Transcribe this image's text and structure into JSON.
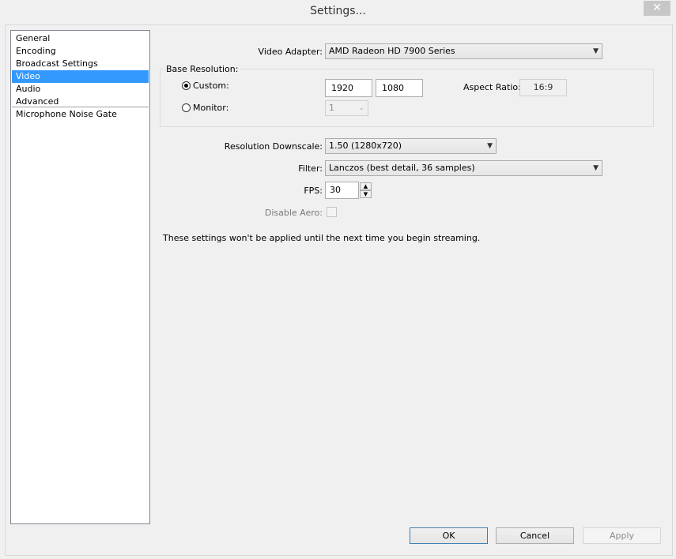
{
  "window": {
    "title": "Settings..."
  },
  "sidebar": {
    "items": [
      {
        "label": "General"
      },
      {
        "label": "Encoding"
      },
      {
        "label": "Broadcast Settings"
      },
      {
        "label": "Video"
      },
      {
        "label": "Audio"
      },
      {
        "label": "Advanced"
      },
      {
        "label": "Microphone Noise Gate"
      }
    ],
    "selected": "Video"
  },
  "video": {
    "adapter_label": "Video Adapter:",
    "adapter_value": "AMD Radeon HD 7900 Series",
    "base_resolution_label": "Base Resolution:",
    "custom_label": "Custom:",
    "custom_width": "1920",
    "custom_height": "1080",
    "aspect_ratio_label": "Aspect Ratio:",
    "aspect_ratio_value": "16:9",
    "monitor_label": "Monitor:",
    "monitor_value": "1",
    "downscale_label": "Resolution Downscale:",
    "downscale_value": "1.50  (1280x720)",
    "filter_label": "Filter:",
    "filter_value": "Lanczos (best detail, 36 samples)",
    "fps_label": "FPS:",
    "fps_value": "30",
    "disable_aero_label": "Disable Aero:",
    "notice": "These settings won't be applied until the next time you begin streaming."
  },
  "buttons": {
    "ok": "OK",
    "cancel": "Cancel",
    "apply": "Apply"
  },
  "icons": {
    "close": "close-icon",
    "dropdown": "chevron-down-icon",
    "spin_up": "arrow-up-icon",
    "spin_down": "arrow-down-icon"
  },
  "colors": {
    "selection": "#3399ff",
    "default_button_border": "#3c7fb1"
  }
}
